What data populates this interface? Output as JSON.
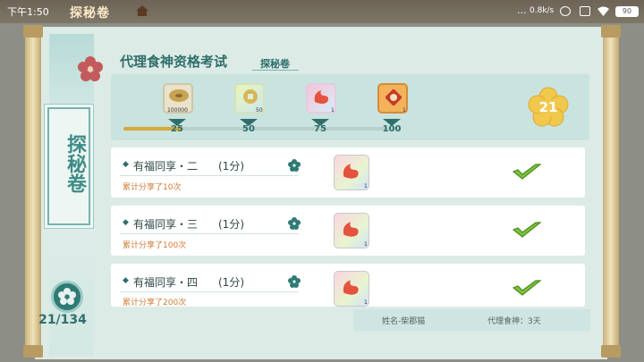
{
  "status_bar": {
    "time": "下午1:50",
    "dots": "...",
    "net_speed": "0.8k/s",
    "battery": "90"
  },
  "game_title": "探秘卷",
  "header": {
    "title": "代理食神资格考试",
    "subtitle": "探秘卷"
  },
  "side": {
    "title": "探秘卷",
    "progress": "21/134"
  },
  "rewards": [
    {
      "icon": "shell-coin-icon",
      "count": "100000",
      "milestone": "25"
    },
    {
      "icon": "jade-coin-icon",
      "count": "50",
      "milestone": "50"
    },
    {
      "icon": "flame-emblem-icon",
      "count": "1",
      "milestone": "75"
    },
    {
      "icon": "red-seal-icon",
      "count": "1",
      "milestone": "100"
    }
  ],
  "progress_fraction": 0.21,
  "score": "21",
  "tasks": [
    {
      "name": "有福同享・二",
      "points": "(1分)",
      "desc": "累计分享了10次",
      "reward_count": "1"
    },
    {
      "name": "有福同享・三",
      "points": "(1分)",
      "desc": "累计分享了100次",
      "reward_count": "1"
    },
    {
      "name": "有福同享・四",
      "points": "(1分)",
      "desc": "累计分享了200次",
      "reward_count": "1"
    }
  ],
  "footer": {
    "name": "姓名-柴郡猫",
    "days": "代理食神：3天"
  },
  "colors": {
    "teal": "#2f6e6a",
    "accent_orange": "#d07b36",
    "gold": "#d6a93a",
    "check_green": "#7cc23a"
  }
}
